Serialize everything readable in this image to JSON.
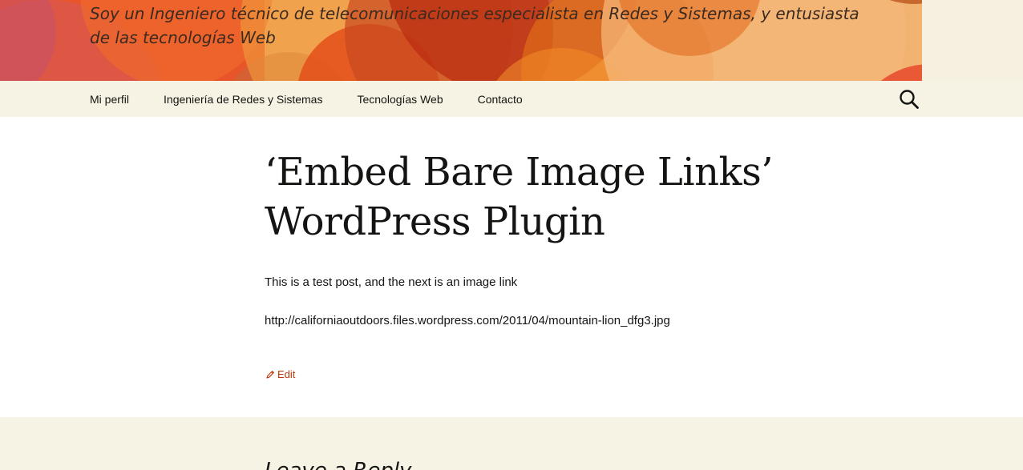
{
  "header": {
    "tagline": "Soy un Ingeniero técnico de telecomunicaciones especialista en Redes y Sistemas, y entusiasta de las tecnologías Web"
  },
  "nav": {
    "items": [
      {
        "label": "Mi perfil"
      },
      {
        "label": "Ingeniería de Redes y Sistemas"
      },
      {
        "label": "Tecnologías Web"
      },
      {
        "label": "Contacto"
      }
    ],
    "search_icon": "search-icon"
  },
  "post": {
    "title_line1": "‘Embed Bare Image Links’",
    "title_line2": "WordPress Plugin",
    "paragraph1": "This is a test post, and the next is an image link",
    "paragraph2": "http://californiaoutdoors.files.wordpress.com/2011/04/mountain-lion_dfg3.jpg",
    "edit_label": "Edit",
    "edit_icon": "pencil-icon"
  },
  "footer": {
    "heading_partial": "Leave a Reply"
  },
  "colors": {
    "nav_bg": "#f6f2e4",
    "link": "#bc360a",
    "text": "#141412"
  }
}
